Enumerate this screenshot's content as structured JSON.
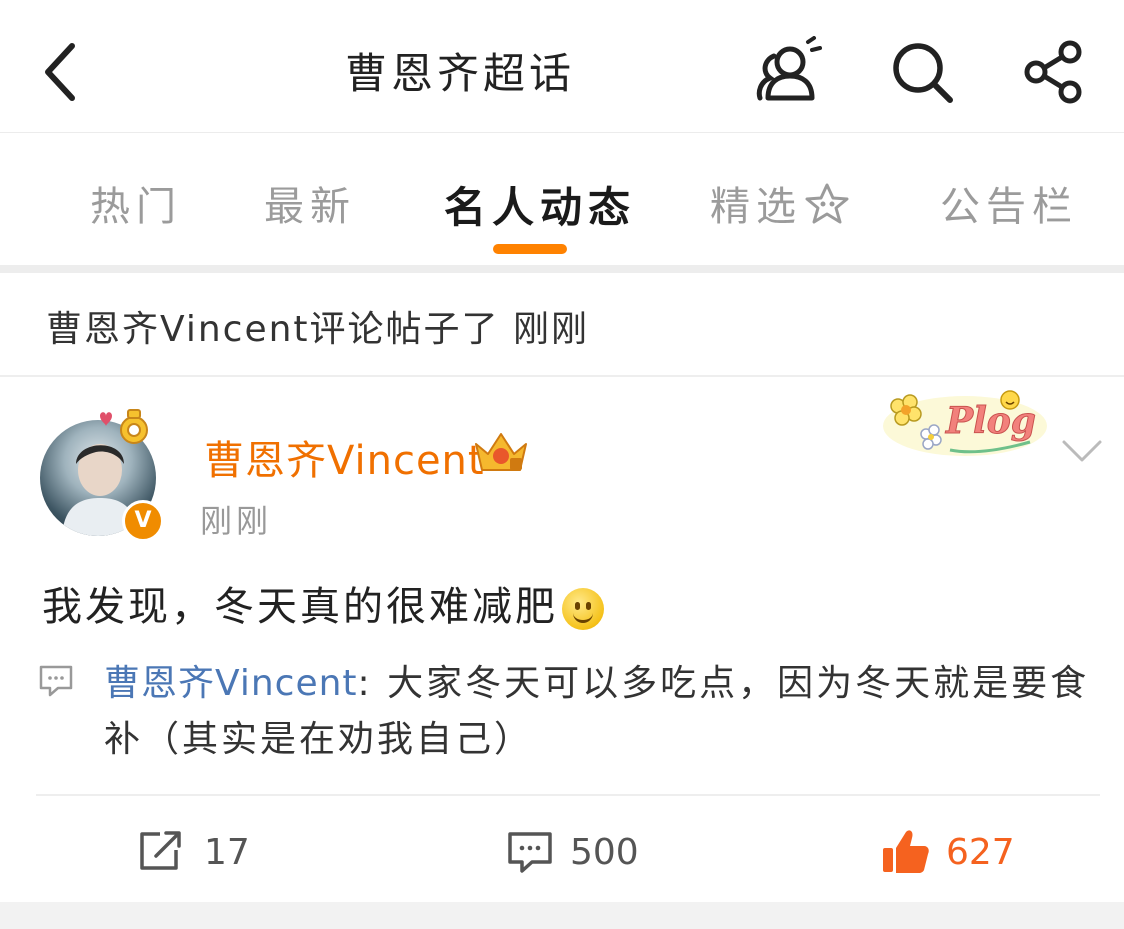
{
  "header": {
    "title": "曹恩齐超话",
    "icons": [
      "back-icon",
      "members-icon",
      "search-icon",
      "share-icon"
    ]
  },
  "tabs": [
    {
      "label": "热门"
    },
    {
      "label": "最新"
    },
    {
      "label": "名人动态",
      "active": true
    },
    {
      "label": "精选"
    },
    {
      "label": "公告栏"
    }
  ],
  "notice": "曹恩齐Vincent评论帖子了 刚刚",
  "post": {
    "author": "曹恩齐Vincent",
    "verified_badge": "V",
    "time": "刚刚",
    "content": "我发现，冬天真的很难减肥",
    "content_emoji": "smile-emoji",
    "sticker": "Plog",
    "comment": {
      "author": "曹恩齐Vincent",
      "separator": ":",
      "text": "大家冬天可以多吃点，因为冬天就是要食补（其实是在劝我自己）"
    }
  },
  "actions": {
    "repost_count": "17",
    "comment_count": "500",
    "like_count": "627"
  },
  "colors": {
    "accent": "#ff8200",
    "username": "#f07000",
    "comment_name": "#4b77b5",
    "like": "#f5621f"
  }
}
